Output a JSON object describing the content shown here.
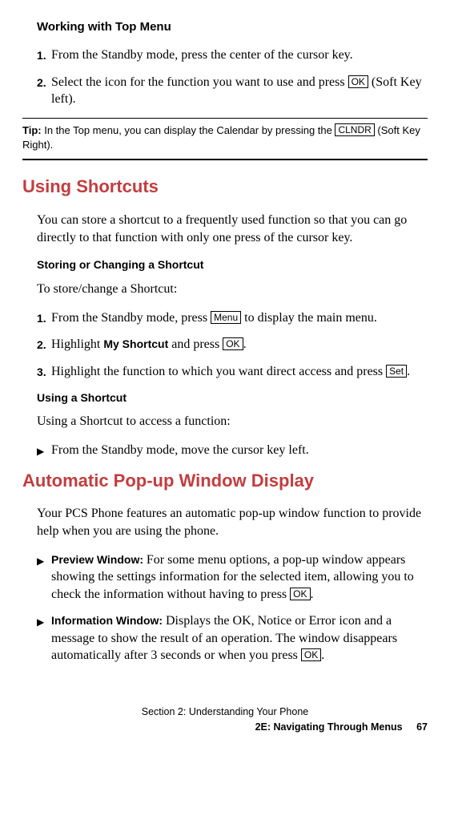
{
  "sec1": {
    "heading": "Working with Top Menu",
    "step1_num": "1.",
    "step1_text": "From the Standby mode, press the center of the cursor key.",
    "step2_num": "2.",
    "step2_a": "Select the icon for the function you want to use and press ",
    "step2_key": "OK",
    "step2_b": " (Soft Key left)."
  },
  "tip": {
    "label": "Tip: ",
    "a": "In the Top menu, you can display the Calendar by pressing the ",
    "key": "CLNDR",
    "b": " (Soft Key Right)."
  },
  "sec2": {
    "heading": "Using Shortcuts",
    "intro": "You can store a shortcut to a frequently used function so that you can go directly to that function with only one press of the cursor key.",
    "sub1": "Storing or Changing a Shortcut",
    "sub1_intro": "To store/change a Shortcut:",
    "s1_num": "1.",
    "s1_a": "From the Standby mode, press ",
    "s1_key": "Menu",
    "s1_b": " to display the main menu.",
    "s2_num": "2.",
    "s2_a": "Highlight ",
    "s2_strong": "My Shortcut",
    "s2_b": " and press ",
    "s2_key": "OK",
    "s2_c": ".",
    "s3_num": "3.",
    "s3_a": "Highlight the function to which you want direct access and press ",
    "s3_key": "Set",
    "s3_b": ".",
    "sub2": "Using a Shortcut",
    "sub2_intro": "Using a Shortcut to access a function:",
    "b1_mark": "▶",
    "b1_text": "From the Standby mode, move the cursor key left."
  },
  "sec3": {
    "heading": "Automatic Pop-up Window Display",
    "intro": "Your PCS Phone features an automatic pop-up window function to provide help when you are using the phone.",
    "b1_mark": "▶",
    "b1_strong": "Preview Window: ",
    "b1_a": "For some menu options, a pop-up window appears showing the settings information for the selected item, allowing you to check the information without having to press ",
    "b1_key": "OK",
    "b1_b": ".",
    "b2_mark": "▶",
    "b2_strong": "Information Window: ",
    "b2_a": "Displays the OK, Notice or Error icon and a message to show the result of an operation. The window disappears automatically after 3 seconds or when you press ",
    "b2_key": "OK",
    "b2_b": "."
  },
  "footer": {
    "line1": "Section 2: Understanding Your Phone",
    "line2": "2E: Navigating Through Menus",
    "pagenum": "67"
  }
}
